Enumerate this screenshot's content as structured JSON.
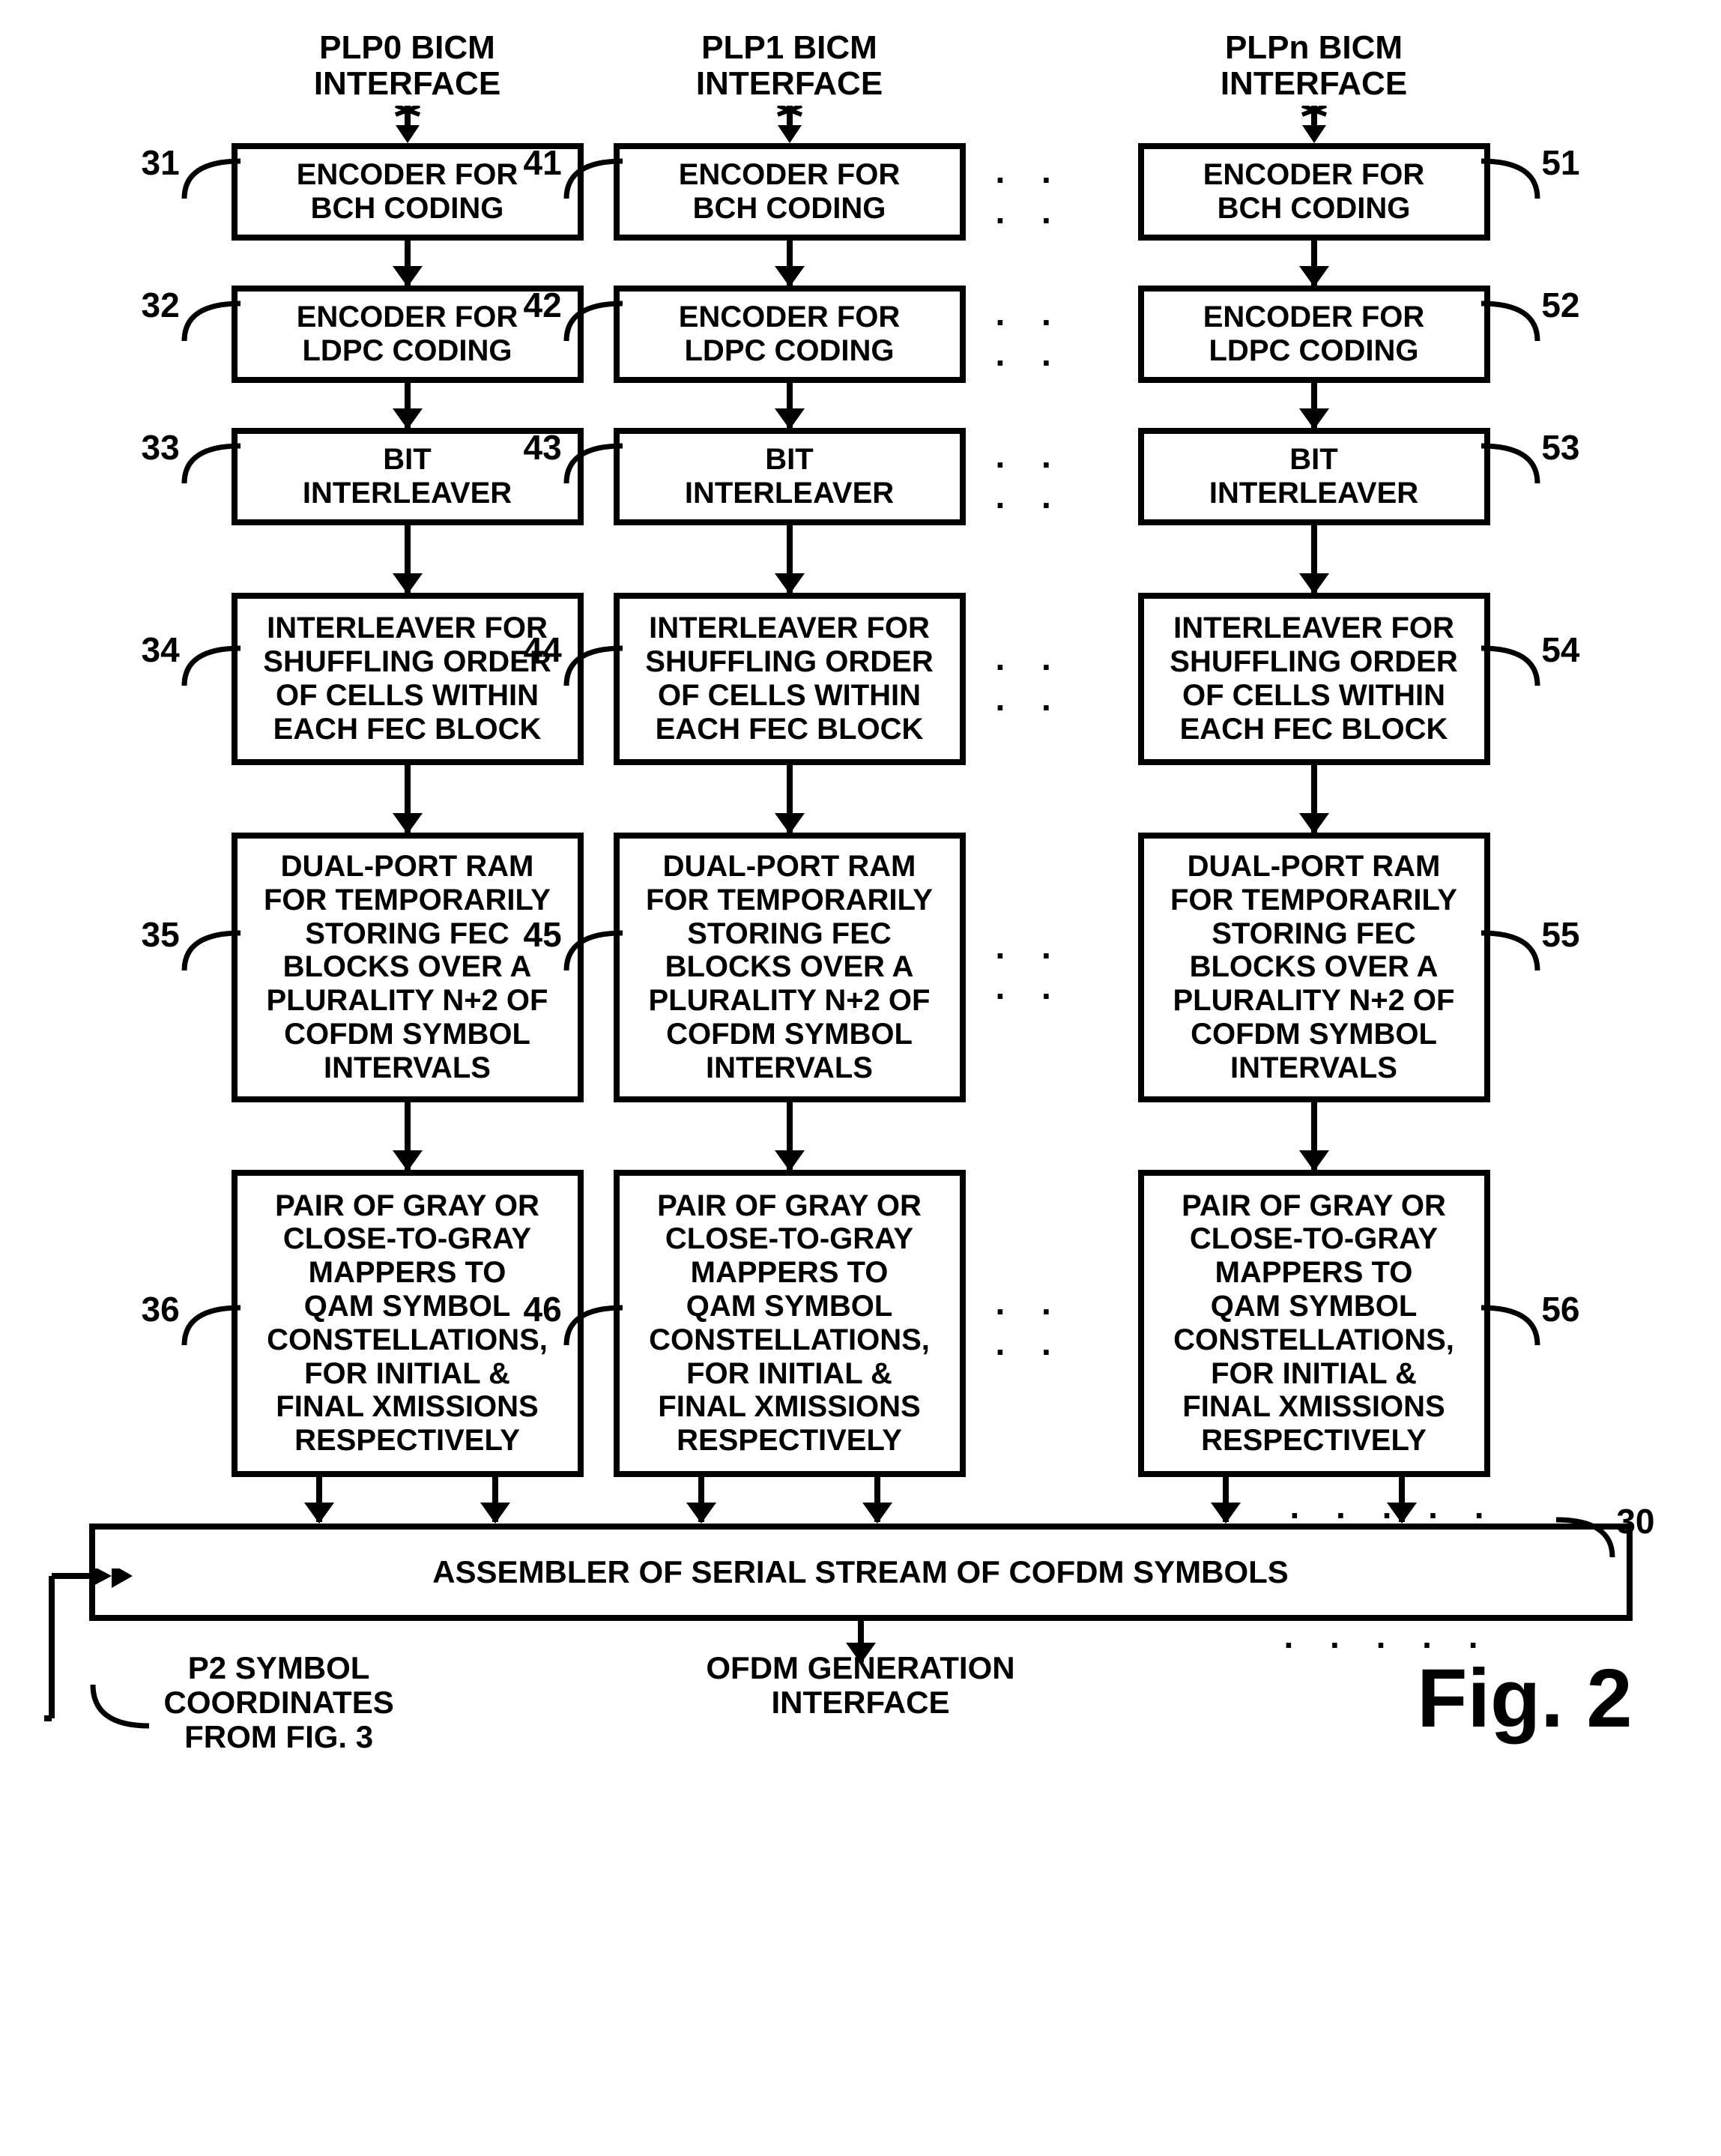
{
  "headers": {
    "col0": "PLP0 BICM\nINTERFACE",
    "col1": "PLP1 BICM\nINTERFACE",
    "coln": "PLPn BICM\nINTERFACE"
  },
  "blocks": {
    "bch": "ENCODER FOR\nBCH CODING",
    "ldpc": "ENCODER FOR\nLDPC CODING",
    "bit": "BIT\nINTERLEAVER",
    "shuffle": "INTERLEAVER FOR\nSHUFFLING ORDER\nOF CELLS WITHIN\nEACH FEC BLOCK",
    "ram": "DUAL-PORT RAM\nFOR TEMPORARILY\nSTORING  FEC\nBLOCKS OVER A\nPLURALITY N+2 OF\nCOFDM SYMBOL\nINTERVALS",
    "ram2": "DUAL-PORT RAM\nFOR TEMPORARILY\nSTORING FEC\nBLOCKS OVER A\nPLURALITY N+2 OF\nCOFDM SYMBOL\nINTERVALS",
    "mapper": "PAIR OF GRAY OR\nCLOSE-TO-GRAY\nMAPPERS TO\nQAM SYMBOL\nCONSTELLATIONS,\nFOR INITIAL &\nFINAL XMISSIONS\nRESPECTIVELY"
  },
  "assembler": "ASSEMBLER OF SERIAL STREAM OF COFDM SYMBOLS",
  "bottom": {
    "p2": "P2 SYMBOL\nCOORDINATES\nFROM FIG. 3",
    "ofdm": "OFDM GENERATION\nINTERFACE",
    "fig": "Fig. 2"
  },
  "refs": {
    "c0": [
      "31",
      "32",
      "33",
      "34",
      "35",
      "36"
    ],
    "c1": [
      "41",
      "42",
      "43",
      "44",
      "45",
      "46"
    ],
    "cn": [
      "51",
      "52",
      "53",
      "54",
      "55",
      "56"
    ],
    "asm": "30"
  },
  "dots": ". . . .",
  "dots5": ". . . . ."
}
